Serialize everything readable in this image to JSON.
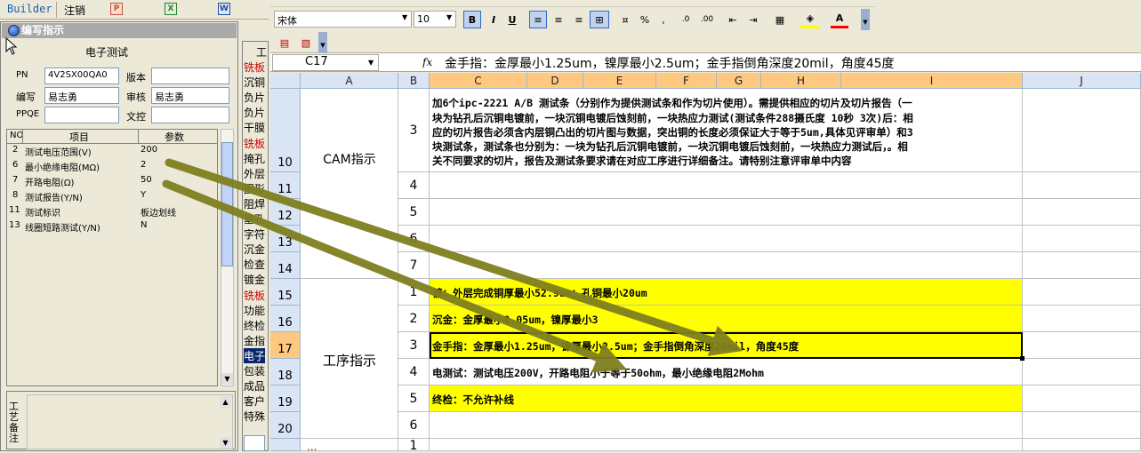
{
  "topbar": {
    "builder": "Builder",
    "cancel": "注销"
  },
  "panel": {
    "title": "编写指示",
    "section": "电子测试",
    "pn_label": "PN",
    "pn_value": "4V2SX00QA0",
    "version_label": "版本",
    "version_value": "",
    "writer_label": "编写",
    "writer_value": "易志勇",
    "reviewer_label": "审核",
    "reviewer_value": "易志勇",
    "ppqe_label": "PPQE",
    "ppqe_value": "",
    "control_label": "文控",
    "control_value": "",
    "table_headers": [
      "NO",
      "项目",
      "参数"
    ],
    "rows": [
      {
        "no": "2",
        "item": "测试电压范围(V)",
        "param": "200"
      },
      {
        "no": "6",
        "item": "最小绝缘电阻(MΩ)",
        "param": "2"
      },
      {
        "no": "7",
        "item": "开路电阻(Ω)",
        "param": "50"
      },
      {
        "no": "8",
        "item": "测试报告(Y/N)",
        "param": "Y"
      },
      {
        "no": "11",
        "item": "测试标识",
        "param": "板边划线"
      },
      {
        "no": "13",
        "item": "线圈短路测试(Y/N)",
        "param": "N"
      }
    ],
    "notes_label": "工艺备注"
  },
  "side_header": "工",
  "side_items": [
    {
      "label": "铣板",
      "red": true
    },
    {
      "label": "沉铜",
      "red": false
    },
    {
      "label": "负片",
      "red": false
    },
    {
      "label": "负片",
      "red": false
    },
    {
      "label": "干膜",
      "red": false
    },
    {
      "label": "铣板",
      "red": true
    },
    {
      "label": "掩孔",
      "red": false
    },
    {
      "label": "外层",
      "red": false
    },
    {
      "label": "图形",
      "red": false
    },
    {
      "label": "阻焊",
      "red": false
    },
    {
      "label": "塞孔",
      "red": false
    },
    {
      "label": "字符",
      "red": false
    },
    {
      "label": "沉金",
      "red": false
    },
    {
      "label": "检查",
      "red": false
    },
    {
      "label": "镀金",
      "red": false
    },
    {
      "label": "铣板",
      "red": true
    },
    {
      "label": "功能",
      "red": false
    },
    {
      "label": "终检",
      "red": false
    },
    {
      "label": "金指",
      "red": false
    },
    {
      "label": "电子",
      "red": false,
      "selected": true
    },
    {
      "label": "包装",
      "red": false
    },
    {
      "label": "成品",
      "red": false
    },
    {
      "label": "客户",
      "red": false
    },
    {
      "label": "特殊",
      "red": false
    }
  ],
  "excel": {
    "font_name": "宋体",
    "font_size": "10",
    "cell_ref": "C17",
    "fx": "fx",
    "formula": "金手指：金厚最小1.25um，镍厚最小2.5um；金手指倒角深度20mil，角度45度",
    "columns": [
      "A",
      "B",
      "C",
      "D",
      "E",
      "F",
      "G",
      "H",
      "I",
      "J"
    ],
    "row_numbers": [
      "10",
      "11",
      "12",
      "13",
      "14",
      "15",
      "16",
      "17",
      "18",
      "19",
      "20"
    ],
    "cam_label": "CAM指示",
    "process_label": "工序指示",
    "cam_nums": [
      "3",
      "4",
      "5",
      "6",
      "7"
    ],
    "process_nums": [
      "1",
      "2",
      "3",
      "4",
      "5",
      "6"
    ],
    "cam_text": [
      "加6个ipc-2221 A/B 测试条（分别作为提供测试条和作为切片使用）。需提供相应的切片及切片报告（一",
      "块为钻孔后沉铜电镀前，一块沉铜电镀后蚀刻前，一块热应力测试(测试条件288摄氏度 10秒 3次)后：相",
      "应的切片报告必须含内层铜凸出的切片图与数据，突出铜的长度必须保证大于等于5um,具体见评审单）和3",
      "块测试条，测试条也分别为：一块为钻孔后沉铜电镀前，一块沉铜电镀后蚀刻前，一块热应力测试后，。相",
      "关不同要求的切片，报告及测试条要求请在对应工序进行详细备注。请特别注意评审单中内容"
    ],
    "process_text": [
      "镀：外层完成铜厚最小52.9um；孔铜最小20um",
      "沉金：金厚最小0.05um，镍厚最小3",
      "金手指：金厚最小1.25um，镍厚最小2.5um；金手指倒角深度20mil，角度45度",
      "电测试：测试电压200V，开路电阻小于等于50ohm，最小绝缘电阻2Mohm",
      "终检：不允许补线",
      ""
    ],
    "next_label": "...",
    "next_num": "1"
  },
  "colors": {
    "arrow": "#7f7f1f",
    "highlight": "#ffff00",
    "header": "#d9e4f5"
  }
}
